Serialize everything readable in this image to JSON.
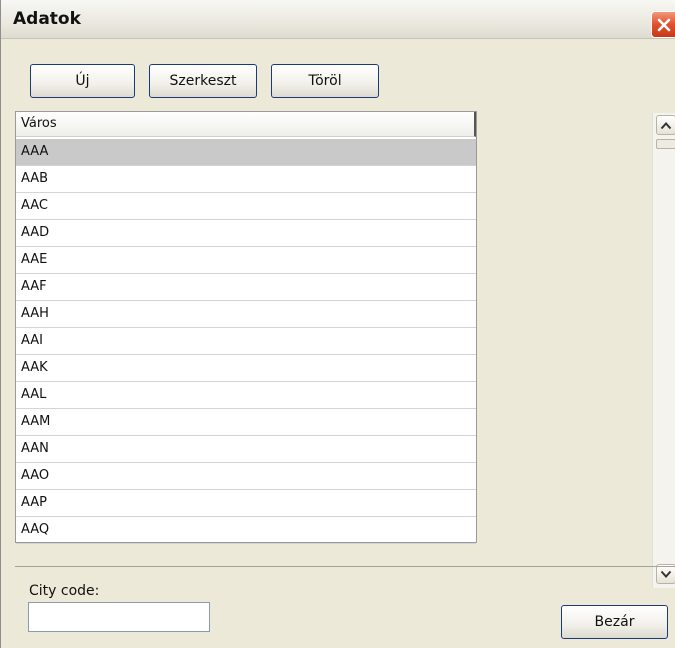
{
  "window": {
    "title": "Adatok"
  },
  "toolbar": {
    "new_label": "Új",
    "edit_label": "Szerkeszt",
    "delete_label": "Töröl"
  },
  "grid": {
    "column_header": "Város",
    "rows": [
      "AAA",
      "AAB",
      "AAC",
      "AAD",
      "AAE",
      "AAF",
      "AAH",
      "AAI",
      "AAK",
      "AAL",
      "AAM",
      "AAN",
      "AAO",
      "AAP",
      "AAQ"
    ],
    "selected_index": 0
  },
  "form": {
    "city_code_label": "City code:",
    "city_code_value": ""
  },
  "footer": {
    "close_label": "Bezár"
  },
  "colors": {
    "close_button": "#e0502d",
    "selected_row": "#c9c9c9",
    "window_bg": "#ece9d8"
  }
}
